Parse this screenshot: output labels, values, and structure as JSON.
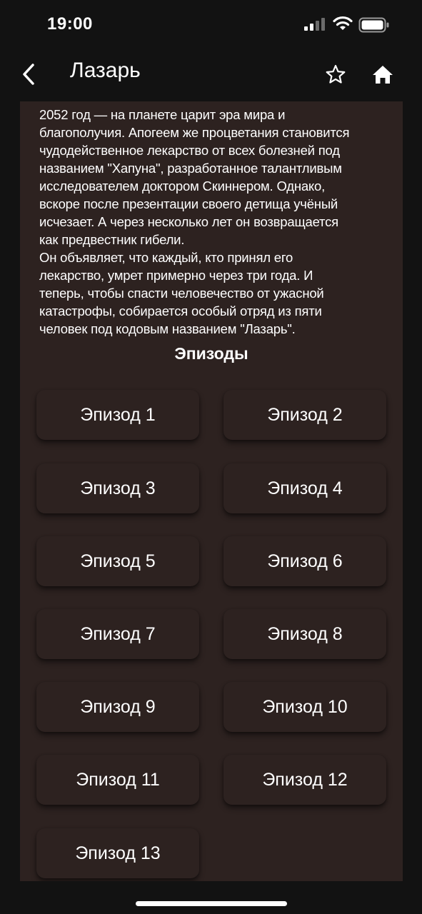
{
  "status_bar": {
    "time": "19:00"
  },
  "header": {
    "title": "Лазарь"
  },
  "description": "2052 год — на планете царит эра мира и\nблагополучия. Апогеем же процветания становится\nчудодейственное лекарство от всех болезней под\nназванием \"Хапуна\", разработанное талантливым\nисследователем доктором Скиннером. Однако,\nвскоре после презентации своего детища учёный\nисчезает. А через несколько лет он возвращается\nкак предвестник гибели.\nОн объявляет, что каждый, кто принял его\nлекарство, умрет примерно через три года. И\nтеперь, чтобы спасти человечество от ужасной\nкатастрофы, собирается особый отряд из пяти\nчеловек под кодовым названием \"Лазарь\".",
  "episodes_title": "Эпизоды",
  "episodes": [
    "Эпизод 1",
    "Эпизод 2",
    "Эпизод 3",
    "Эпизод 4",
    "Эпизод 5",
    "Эпизод 6",
    "Эпизод 7",
    "Эпизод 8",
    "Эпизод 9",
    "Эпизод 10",
    "Эпизод 11",
    "Эпизод 12",
    "Эпизод 13"
  ],
  "colors": {
    "background": "#121212",
    "panel": "#2d2220",
    "text": "#ffffff"
  }
}
